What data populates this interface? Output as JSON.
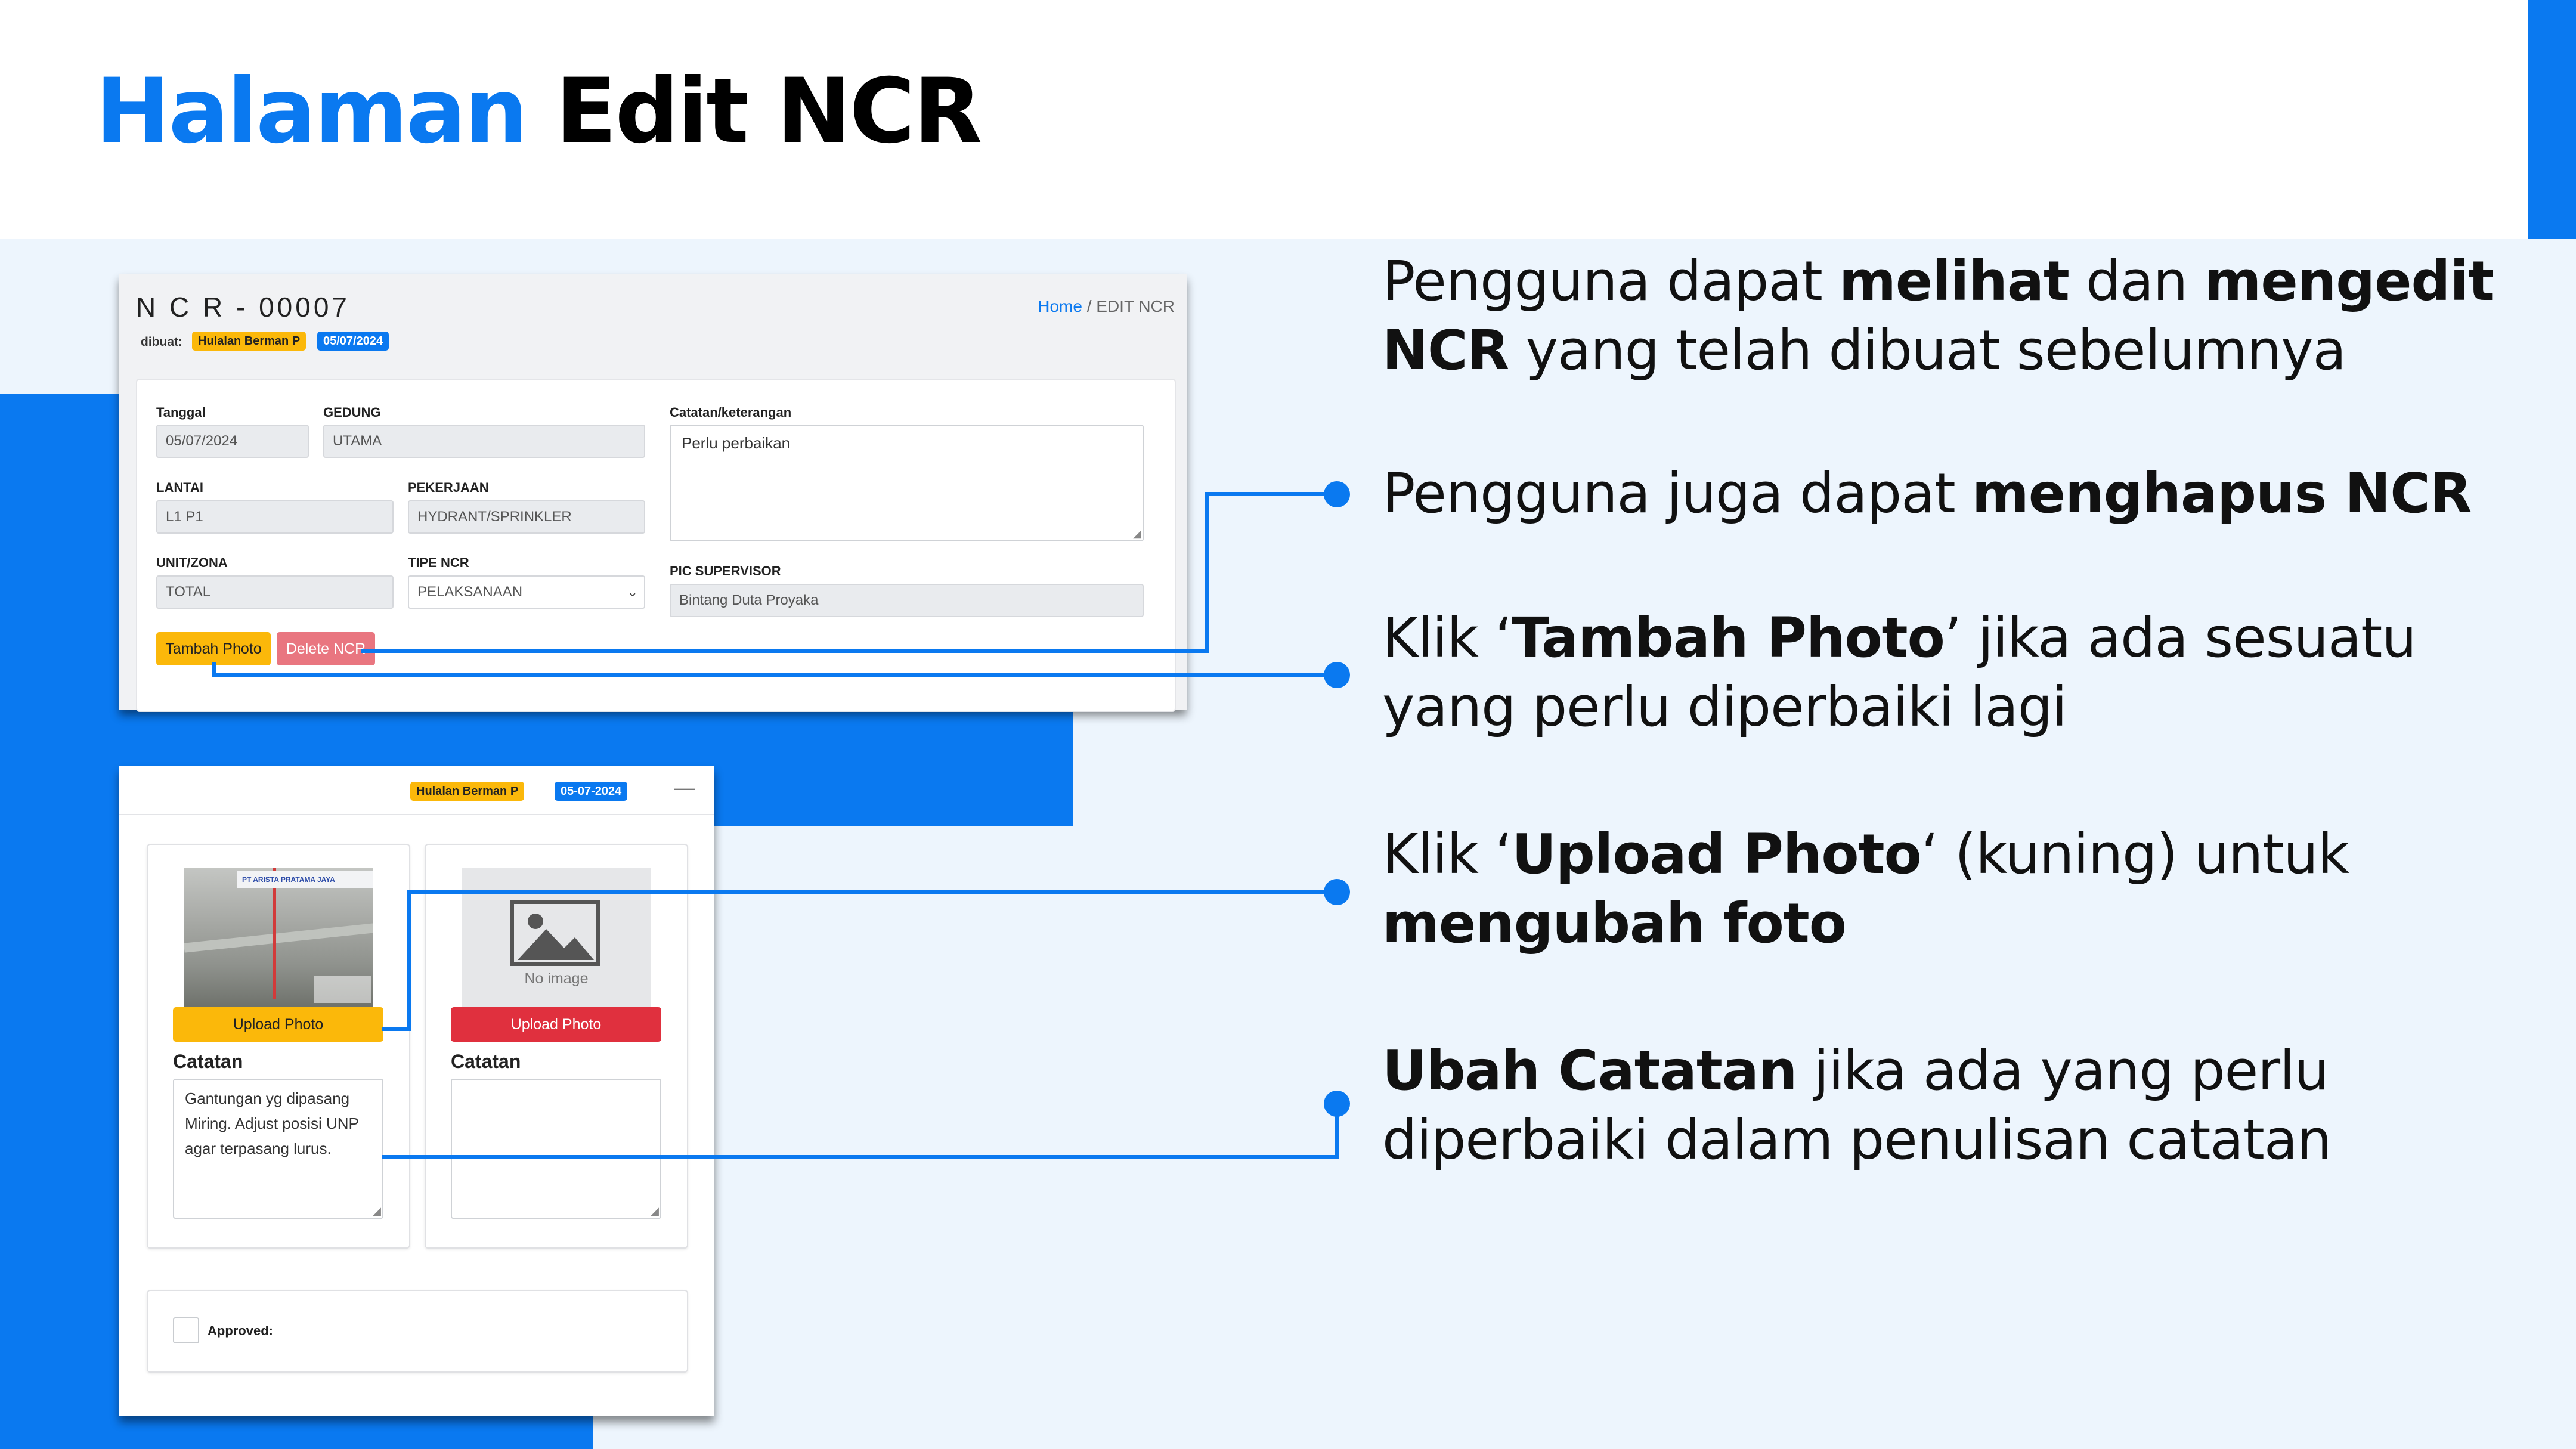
{
  "slide_title": {
    "highlight": "Halaman",
    "rest": "Edit NCR"
  },
  "panel1": {
    "ncr_number": "N C R - 00007",
    "created_label": "dibuat:",
    "creator_badge": "Hulalan Berman P",
    "date_badge": "05/07/2024",
    "breadcrumb": {
      "home": "Home",
      "separator": "/",
      "current": "EDIT NCR"
    },
    "form": {
      "tanggal": {
        "label": "Tanggal",
        "value": "05/07/2024"
      },
      "gedung": {
        "label": "GEDUNG",
        "value": "UTAMA"
      },
      "catatan": {
        "label": "Catatan/keterangan",
        "value": "Perlu perbaikan"
      },
      "lantai": {
        "label": "LANTAI",
        "value": "L1 P1"
      },
      "pekerjaan": {
        "label": "PEKERJAAN",
        "value": "HYDRANT/SPRINKLER"
      },
      "unit_zona": {
        "label": "UNIT/ZONA",
        "value": "TOTAL"
      },
      "tipe_ncr": {
        "label": "TIPE NCR",
        "value": "PELAKSANAAN"
      },
      "pic_supervisor": {
        "label": "PIC SUPERVISOR",
        "value": "Bintang Duta Proyaka"
      }
    },
    "buttons": {
      "tambah_photo": "Tambah Photo",
      "delete_ncr": "Delete NCR"
    }
  },
  "panel2": {
    "creator_badge": "Hulalan Berman P",
    "date_badge": "05-07-2024",
    "collapse_icon": "minus-icon",
    "photo_logo_text": "PT ARISTA PRATAMA JAYA",
    "card1": {
      "upload_button": "Upload Photo",
      "catatan_label": "Catatan",
      "catatan_value": "Gantungan yg dipasang Miring. Adjust posisi UNP agar terpasang lurus."
    },
    "card2": {
      "no_image_text": "No image",
      "upload_button": "Upload Photo",
      "catatan_label": "Catatan",
      "catatan_value": ""
    },
    "approved_label": "Approved:"
  },
  "descriptions": [
    {
      "id": "view-edit",
      "parts": [
        {
          "t": "Pengguna dapat ",
          "b": false
        },
        {
          "t": "melihat",
          "b": true
        },
        {
          "t": " dan ",
          "b": false
        },
        {
          "t": "mengedit",
          "b": true
        },
        {
          "t": "\nNCR",
          "b": true
        },
        {
          "t": " yang telah dibuat sebelumnya",
          "b": false
        }
      ]
    },
    {
      "id": "delete",
      "parts": [
        {
          "t": "Pengguna juga dapat ",
          "b": false
        },
        {
          "t": "menghapus NCR",
          "b": true
        }
      ]
    },
    {
      "id": "tambah-photo",
      "parts": [
        {
          "t": "Klik ‘",
          "b": false
        },
        {
          "t": "Tambah Photo",
          "b": true
        },
        {
          "t": "’ jika ada sesuatu\nyang perlu diperbaiki lagi",
          "b": false
        }
      ]
    },
    {
      "id": "upload-photo",
      "parts": [
        {
          "t": "Klik ‘",
          "b": false
        },
        {
          "t": "Upload Photo",
          "b": true
        },
        {
          "t": "‘ (kuning) untuk\n",
          "b": false
        },
        {
          "t": "mengubah foto",
          "b": true
        }
      ]
    },
    {
      "id": "ubah-catatan",
      "parts": [
        {
          "t": "Ubah Catatan",
          "b": true
        },
        {
          "t": " jika ada yang perlu\ndiperbaiki dalam penulisan catatan",
          "b": false
        }
      ]
    }
  ],
  "colors": {
    "accent": "#0a79f0",
    "yellow": "#fbb80a",
    "pink": "#e97680",
    "red": "#e0303e",
    "background": "#edf5fd"
  }
}
